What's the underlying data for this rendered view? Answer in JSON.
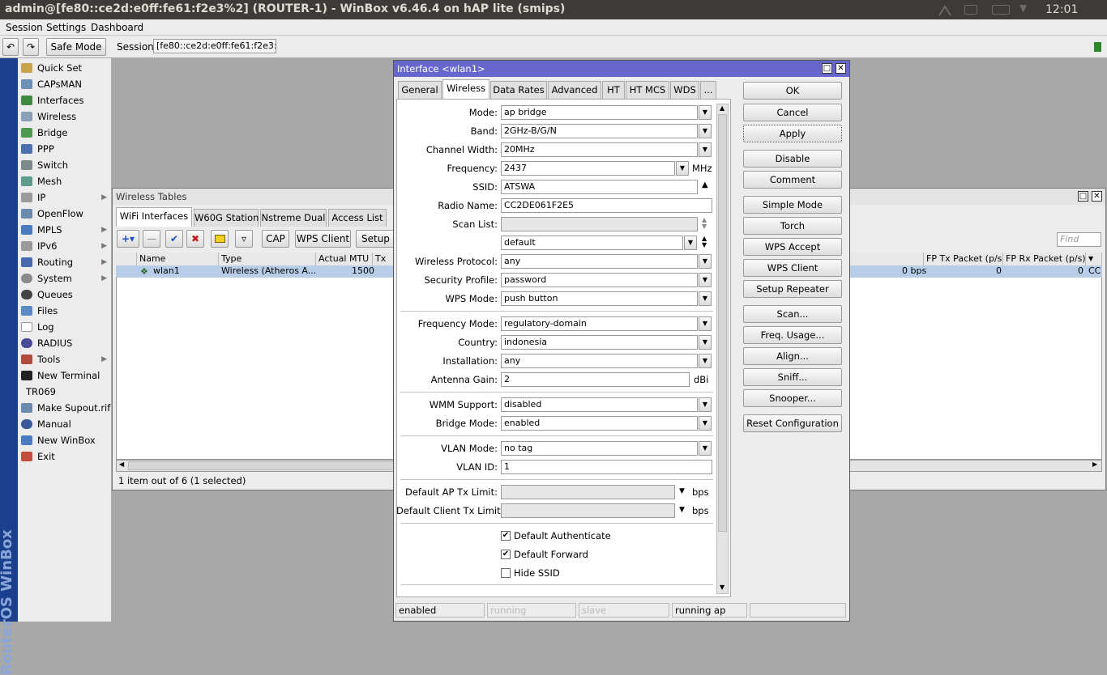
{
  "titlebar": {
    "title": "admin@[fe80::ce2d:e0ff:fe61:f2e3%2] (ROUTER-1) - WinBox v6.46.4 on hAP lite (smips)",
    "clock": "12:01"
  },
  "menubar": {
    "session": "Session",
    "settings": "Settings",
    "dashboard": "Dashboard"
  },
  "toolbar": {
    "safe_mode": "Safe Mode",
    "session_label": "Session:",
    "session_value": "[fe80::ce2d:e0ff:fe61:f2e3:2]"
  },
  "sidestrip": {
    "brand": "RouterOS WinBox"
  },
  "sidebar": {
    "items": [
      {
        "label": "Quick Set"
      },
      {
        "label": "CAPsMAN"
      },
      {
        "label": "Interfaces"
      },
      {
        "label": "Wireless"
      },
      {
        "label": "Bridge"
      },
      {
        "label": "PPP"
      },
      {
        "label": "Switch"
      },
      {
        "label": "Mesh"
      },
      {
        "label": "IP"
      },
      {
        "label": "OpenFlow"
      },
      {
        "label": "MPLS"
      },
      {
        "label": "IPv6"
      },
      {
        "label": "Routing"
      },
      {
        "label": "System"
      },
      {
        "label": "Queues"
      },
      {
        "label": "Files"
      },
      {
        "label": "Log"
      },
      {
        "label": "RADIUS"
      },
      {
        "label": "Tools"
      },
      {
        "label": "New Terminal"
      },
      {
        "label": "TR069"
      },
      {
        "label": "Make Supout.rif"
      },
      {
        "label": "Manual"
      },
      {
        "label": "New WinBox"
      },
      {
        "label": "Exit"
      }
    ]
  },
  "wireless_tables": {
    "title": "Wireless Tables",
    "tabs": [
      "WiFi Interfaces",
      "W60G Station",
      "Nstreme Dual",
      "Access List"
    ],
    "buttons": {
      "cap": "CAP",
      "wps_client": "WPS Client",
      "setup": "Setup R"
    },
    "find_placeholder": "Find",
    "columns": [
      "Name",
      "Type",
      "Actual MTU",
      "Tx",
      "FP Tx Packet (p/s)",
      "FP Rx Packet (p/s)"
    ],
    "row": {
      "name": "wlan1",
      "type": "Wireless (Atheros A...",
      "mtu": "1500",
      "bps": "0 bps",
      "fp_tx": "0",
      "fp_rx": "0",
      "last": "CC"
    },
    "status": "1 item out of 6 (1 selected)"
  },
  "dialog": {
    "title": "Interface <wlan1>",
    "tabs": [
      "General",
      "Wireless",
      "Data Rates",
      "Advanced",
      "HT",
      "HT MCS",
      "WDS",
      "..."
    ],
    "fields": {
      "mode": {
        "label": "Mode:",
        "value": "ap bridge"
      },
      "band": {
        "label": "Band:",
        "value": "2GHz-B/G/N"
      },
      "channel_width": {
        "label": "Channel Width:",
        "value": "20MHz"
      },
      "frequency": {
        "label": "Frequency:",
        "value": "2437",
        "unit": "MHz"
      },
      "ssid": {
        "label": "SSID:",
        "value": "ATSWA"
      },
      "radio_name": {
        "label": "Radio Name:",
        "value": "CC2DE061F2E5"
      },
      "scan_list": {
        "label": "Scan List:",
        "value": "",
        "value2": "default"
      },
      "wireless_protocol": {
        "label": "Wireless Protocol:",
        "value": "any"
      },
      "security_profile": {
        "label": "Security Profile:",
        "value": "password"
      },
      "wps_mode": {
        "label": "WPS Mode:",
        "value": "push button"
      },
      "frequency_mode": {
        "label": "Frequency Mode:",
        "value": "regulatory-domain"
      },
      "country": {
        "label": "Country:",
        "value": "indonesia"
      },
      "installation": {
        "label": "Installation:",
        "value": "any"
      },
      "antenna_gain": {
        "label": "Antenna Gain:",
        "value": "2",
        "unit": "dBi"
      },
      "wmm_support": {
        "label": "WMM Support:",
        "value": "disabled"
      },
      "bridge_mode": {
        "label": "Bridge Mode:",
        "value": "enabled"
      },
      "vlan_mode": {
        "label": "VLAN Mode:",
        "value": "no tag"
      },
      "vlan_id": {
        "label": "VLAN ID:",
        "value": "1"
      },
      "default_ap_tx_limit": {
        "label": "Default AP Tx Limit:",
        "value": "",
        "unit": "bps"
      },
      "default_client_tx_limit": {
        "label": "Default Client Tx Limit:",
        "value": "",
        "unit": "bps"
      }
    },
    "checkboxes": {
      "default_authenticate": {
        "label": "Default Authenticate",
        "checked": true
      },
      "default_forward": {
        "label": "Default Forward",
        "checked": true
      },
      "hide_ssid": {
        "label": "Hide SSID",
        "checked": false
      }
    },
    "buttons": [
      "OK",
      "Cancel",
      "Apply",
      "Disable",
      "Comment",
      "Simple Mode",
      "Torch",
      "WPS Accept",
      "WPS Client",
      "Setup Repeater",
      "Scan...",
      "Freq. Usage...",
      "Align...",
      "Sniff...",
      "Snooper...",
      "Reset Configuration"
    ],
    "statusbar": [
      "enabled",
      "running",
      "slave",
      "running ap",
      ""
    ]
  }
}
